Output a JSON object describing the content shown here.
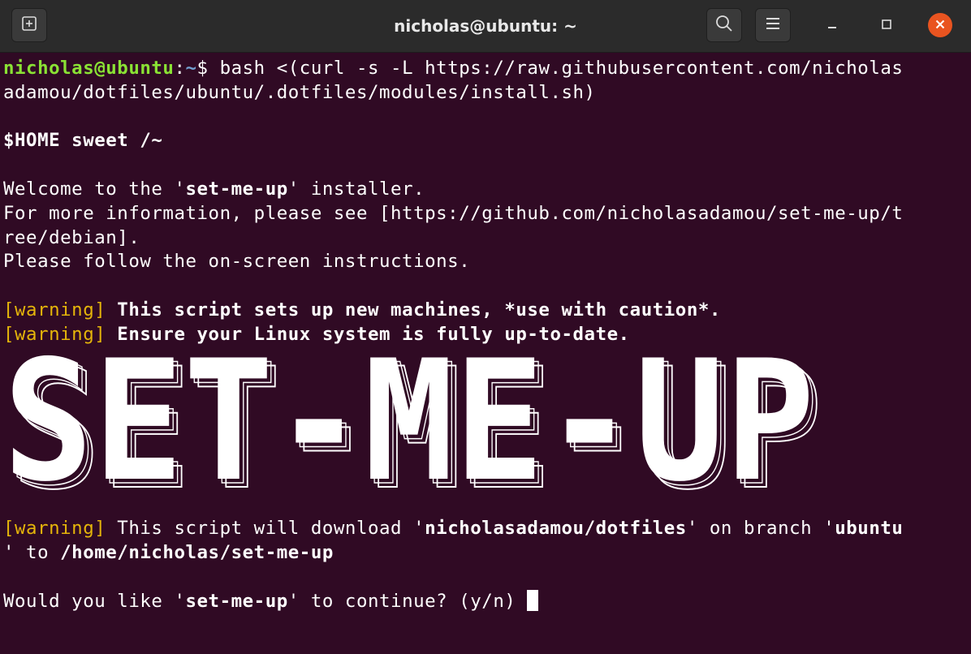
{
  "window": {
    "title": "nicholas@ubuntu: ~",
    "icons": {
      "new_tab": "new-tab-icon",
      "search": "search-icon",
      "menu": "hamburger-menu-icon",
      "minimize": "minimize-icon",
      "maximize": "maximize-icon",
      "close": "close-icon"
    },
    "close_color": "#e95420"
  },
  "terminal": {
    "background": "#300a24",
    "prompt": {
      "user_host": "nicholas@ubuntu",
      "colon": ":",
      "path": "~",
      "dollar": "$",
      "command_line1": " bash <(curl -s -L https://raw.githubusercontent.com/nicholas",
      "command_line2": "adamou/dotfiles/ubuntu/.dotfiles/modules/install.sh)"
    },
    "home_line": "$HOME sweet /~",
    "welcome": {
      "pre": "Welcome to the '",
      "name": "set-me-up",
      "post": "' installer."
    },
    "info_line1": "For more information, please see [https://github.com/nicholasadamou/set-me-up/t",
    "info_line2": "ree/debian].",
    "follow_line": "Please follow the on-screen instructions.",
    "warning_tag": "[warning]",
    "warning1": " This script sets up new machines, *use with caution*.",
    "warning2": " Ensure your Linux system is fully up-to-date.",
    "banner_text": "SET-ME-UP",
    "download": {
      "pre": " This script will download '",
      "repo": "nicholasadamou/dotfiles",
      "mid": "' on branch '",
      "branch": "ubuntu",
      "line2_pre": "' to ",
      "path": "/home/nicholas/set-me-up"
    },
    "question": {
      "pre": "Would you like '",
      "name": "set-me-up",
      "post": "' to continue? (y/n) "
    },
    "colors": {
      "prompt_user": "#8ae234",
      "prompt_path": "#729fcf",
      "warning": "#e5b50a",
      "text": "#ffffff"
    }
  }
}
